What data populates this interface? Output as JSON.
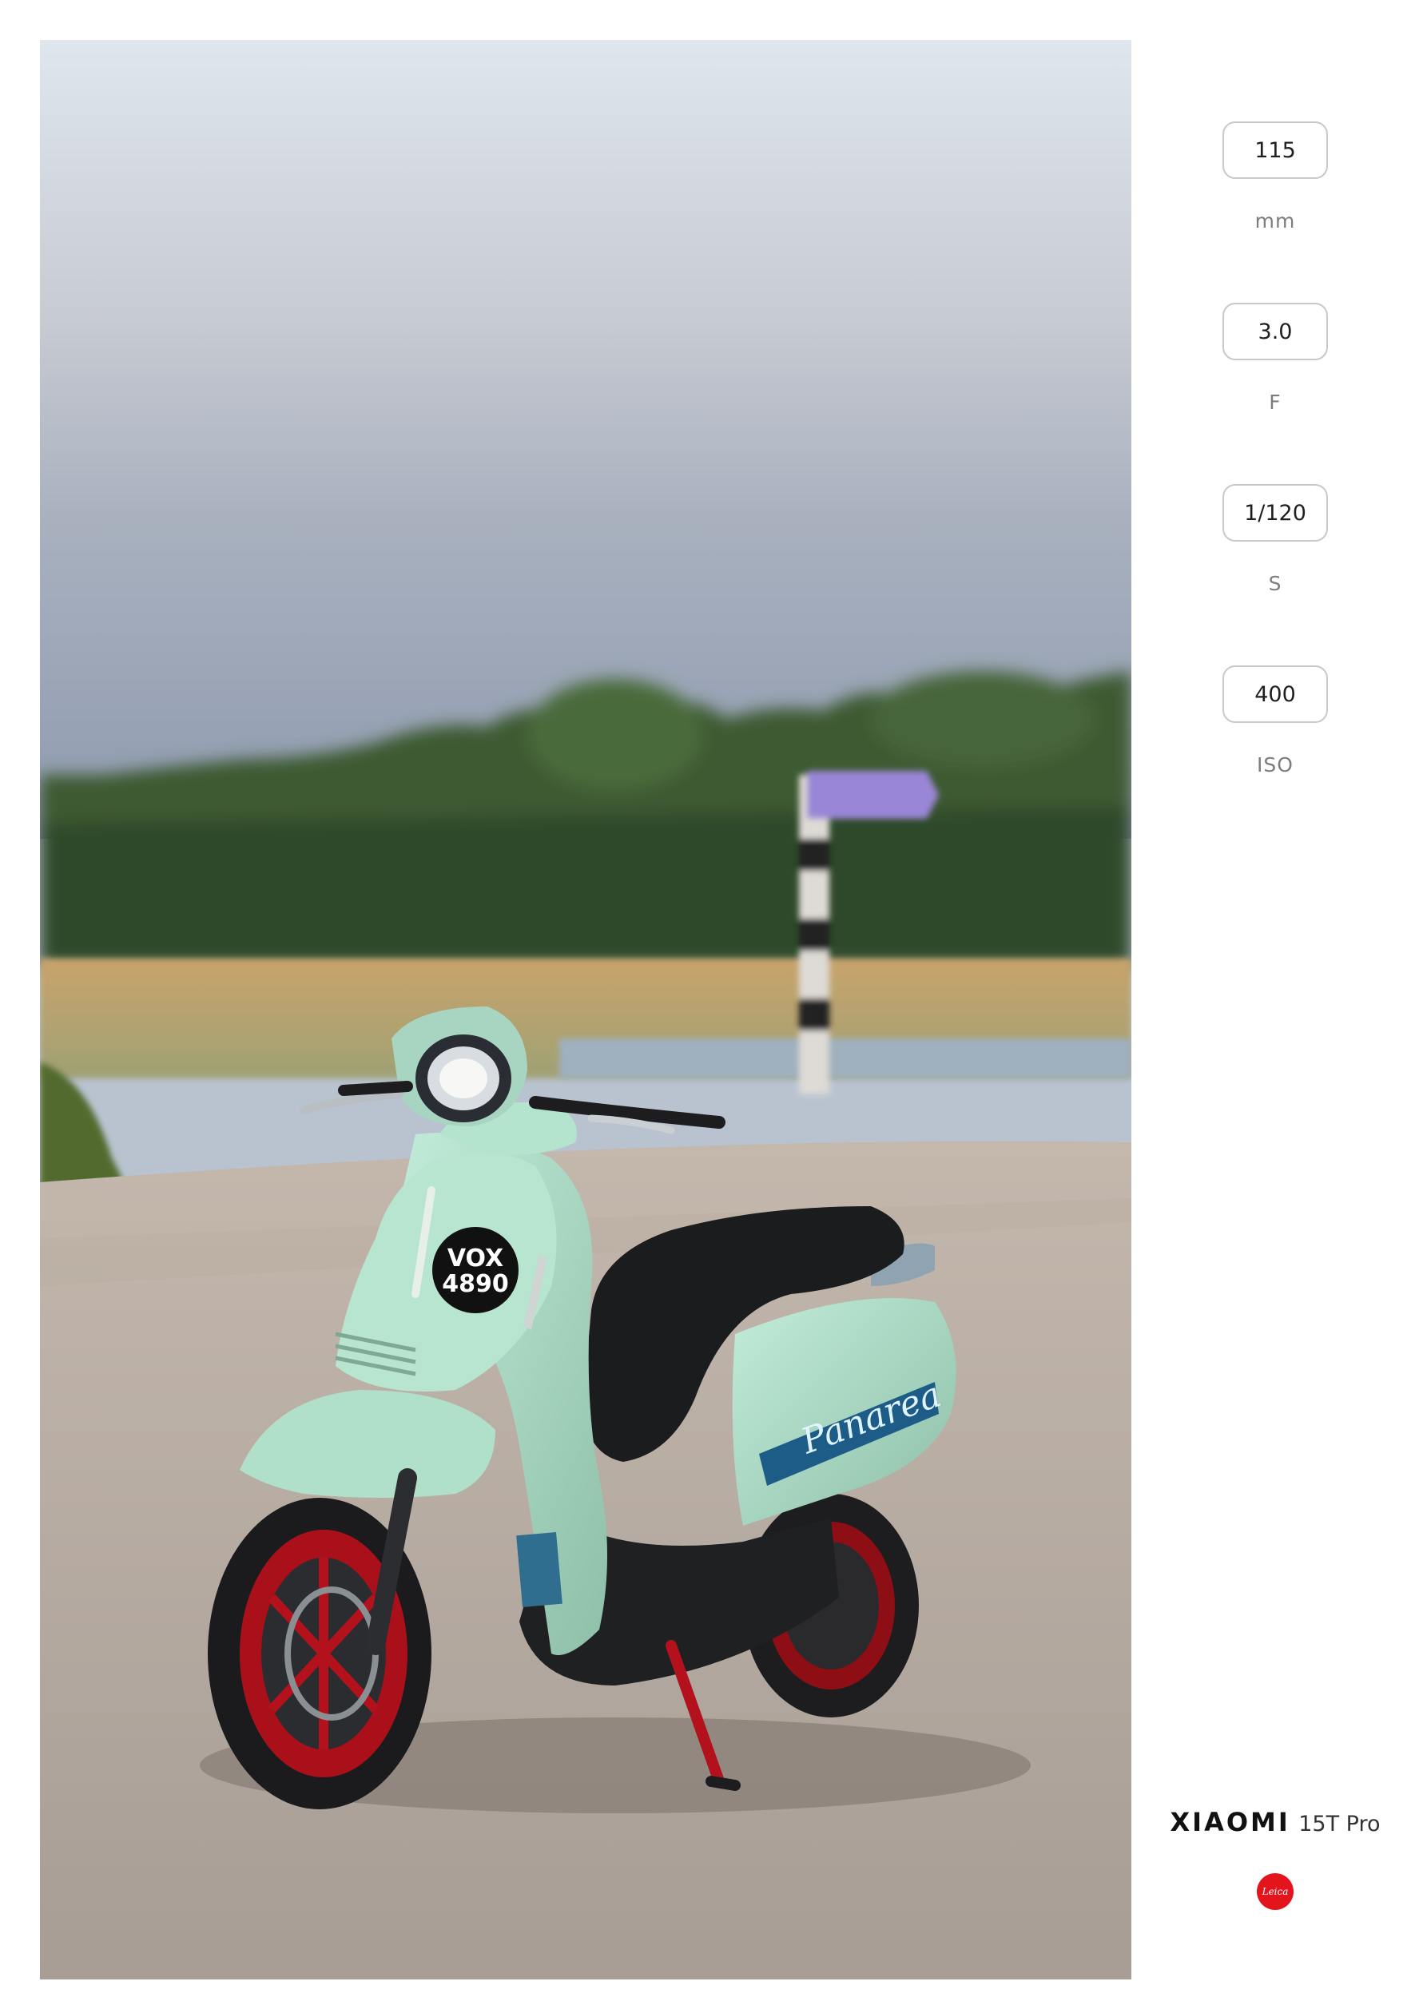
{
  "exif": {
    "focal_length": {
      "value": "115",
      "unit": "mm"
    },
    "aperture": {
      "value": "3.0",
      "unit": "F"
    },
    "shutter": {
      "value": "1/120",
      "unit": "S"
    },
    "iso": {
      "value": "400",
      "unit": "ISO"
    }
  },
  "brand": {
    "logo_text": "XIAOMI",
    "model": "15T Pro",
    "badge_text": "Leica",
    "badge_color": "#e3141c"
  },
  "photo": {
    "plate_line1": "VOX",
    "plate_line2": "4890",
    "panel_script": "Panarea",
    "body_color": "#a9d8c4",
    "wheel_color": "#b3121c"
  }
}
